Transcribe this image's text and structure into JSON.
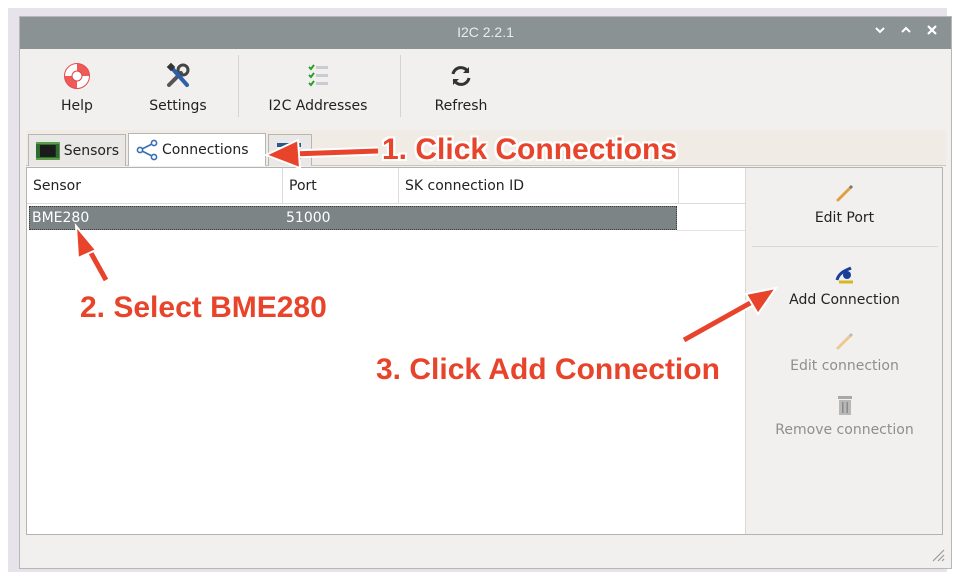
{
  "window": {
    "title": "I2C 2.2.1"
  },
  "window_controls": {
    "minimize": "⌄",
    "maximize": "^",
    "close": "×"
  },
  "toolbar": {
    "help": "Help",
    "settings": "Settings",
    "i2c_addresses": "I2C Addresses",
    "refresh": "Refresh"
  },
  "tabs": [
    {
      "label": "Sensors",
      "icon": "chip-icon"
    },
    {
      "label": "Connections",
      "icon": "share-icon",
      "selected": true
    },
    {
      "label": "",
      "icon": "list-icon"
    }
  ],
  "table": {
    "columns": [
      "Sensor",
      "Port",
      "SK connection ID"
    ],
    "rows": [
      {
        "sensor": "BME280",
        "port": "51000",
        "sk_connection_id": "",
        "selected": true
      }
    ]
  },
  "side_actions": {
    "edit_port": "Edit Port",
    "add_connection": "Add Connection",
    "edit_connection": "Edit connection",
    "remove_connection": "Remove connection"
  },
  "annotations": {
    "step1": "1. Click Connections",
    "step2": "2. Select BME280",
    "step3": "3. Click Add Connection"
  },
  "colors": {
    "titlebar": "#8a9294",
    "selection": "#7c8486",
    "annotation": "#e8432b"
  }
}
